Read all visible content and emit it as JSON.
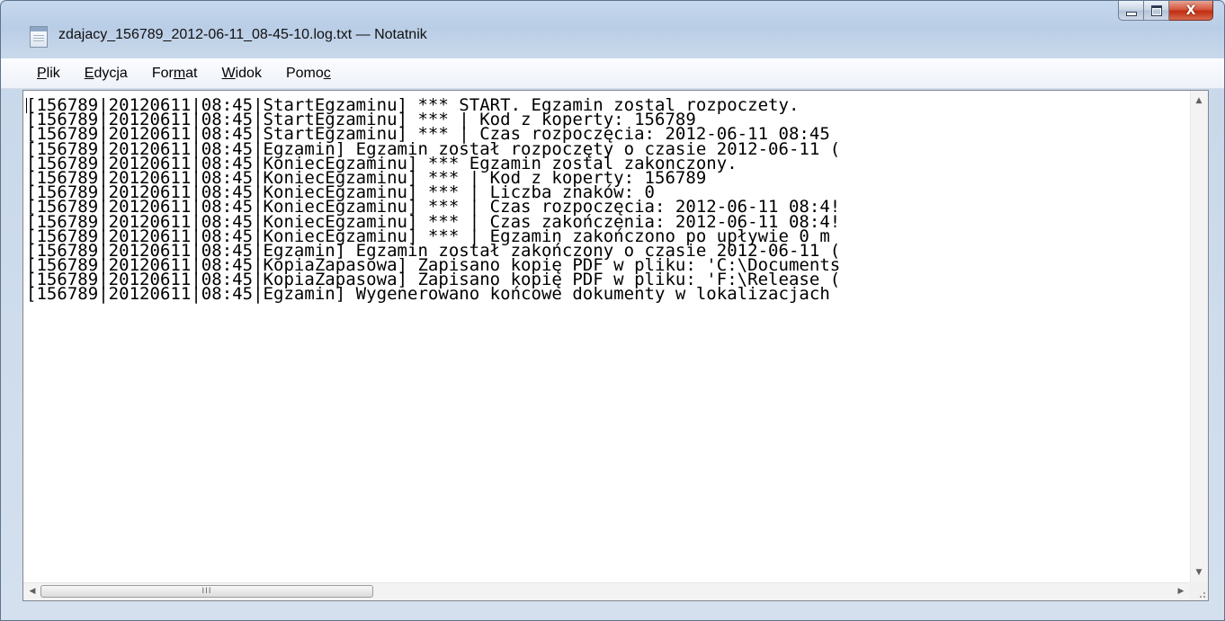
{
  "window": {
    "title": "zdajacy_156789_2012-06-11_08-45-10.log.txt — Notatnik",
    "close_glyph": "X"
  },
  "menu": {
    "items": [
      {
        "pre": "",
        "key": "P",
        "post": "lik"
      },
      {
        "pre": "",
        "key": "E",
        "post": "dycja"
      },
      {
        "pre": "For",
        "key": "m",
        "post": "at"
      },
      {
        "pre": "",
        "key": "W",
        "post": "idok"
      },
      {
        "pre": "Pomo",
        "key": "c",
        "post": ""
      }
    ]
  },
  "editor": {
    "lines": [
      "[156789|20120611|08:45|StartEgzaminu] *** START. Egzamin zostal rozpoczety.",
      "[156789|20120611|08:45|StartEgzaminu] *** | Kod z koperty: 156789",
      "[156789|20120611|08:45|StartEgzaminu] *** | Czas rozpoczęcia: 2012-06-11 08:45",
      "[156789|20120611|08:45|Egzamin] Egzamin został rozpoczęty o czasie 2012-06-11 (",
      "[156789|20120611|08:45|KoniecEgzaminu] *** Egzamin zostal zakonczony.",
      "[156789|20120611|08:45|KoniecEgzaminu] *** | Kod z koperty: 156789",
      "[156789|20120611|08:45|KoniecEgzaminu] *** | Liczba znaków: 0",
      "[156789|20120611|08:45|KoniecEgzaminu] *** | Czas rozpoczęcia: 2012-06-11 08:4!",
      "[156789|20120611|08:45|KoniecEgzaminu] *** | Czas zakończenia: 2012-06-11 08:4!",
      "[156789|20120611|08:45|KoniecEgzaminu] *** | Egzamin zakończono po upływie 0 m",
      "[156789|20120611|08:45|Egzamin] Egzamin został zakończony o czasie 2012-06-11 (",
      "[156789|20120611|08:45|KopiaZapasowa] Zapisano kopię PDF w pliku: 'C:\\Documents",
      "[156789|20120611|08:45|KopiaZapasowa] Zapisano kopię PDF w pliku: 'F:\\Release (",
      "[156789|20120611|08:45|Egzamin] Wygenerowano końcowe dokumenty w lokalizacjach"
    ]
  },
  "scrollbars": {
    "h_thumb_glyph": "III"
  },
  "icons": {
    "app": "notepad-icon",
    "minimize": "minimize-icon",
    "maximize": "maximize-icon",
    "close": "close-icon"
  }
}
